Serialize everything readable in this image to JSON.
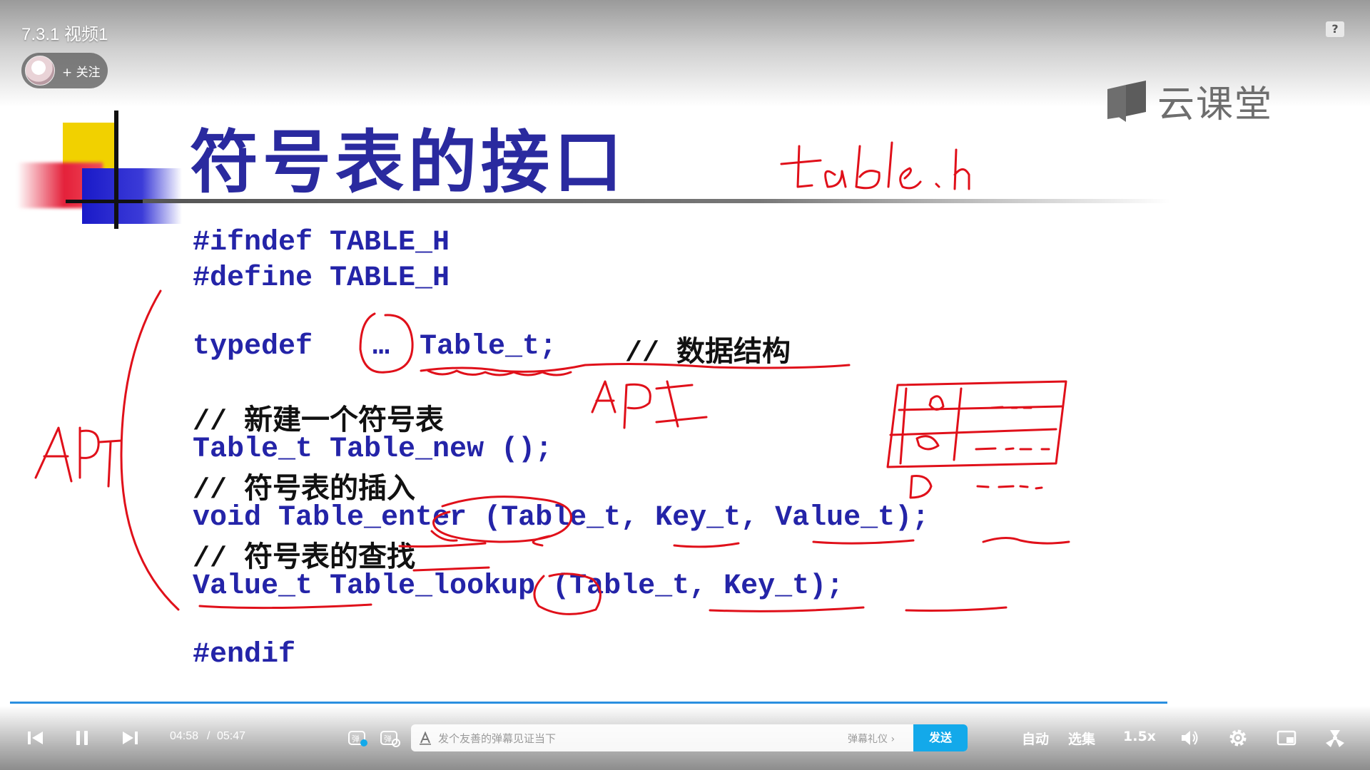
{
  "player": {
    "video_title": "7.3.1 视频1",
    "follow_label": "+ 关注",
    "help_label": "?",
    "brand_text": "云课堂",
    "current_time": "04:58",
    "time_separator": "/",
    "duration": "05:47",
    "progress_fraction": 0.858,
    "danmaku_placeholder": "发个友善的弹幕见证当下",
    "danmaku_etiquette": "弹幕礼仪 ›",
    "send_label": "发送",
    "auto_label": "自动",
    "episodes_label": "选集",
    "speed_label": "1.5x",
    "accent_color": "#13a9ea"
  },
  "slide": {
    "title": "符号表的接口",
    "code_lines": {
      "ifndef": "#ifndef TABLE_H",
      "define": "#define TABLE_H",
      "typedef_kw": "typedef",
      "typedef_dots": "…",
      "typedef_type": "Table_t;",
      "typedef_comment": "// 数据结构",
      "comment_new": "// 新建一个符号表",
      "fn_new": "Table_t Table_new ();",
      "comment_insert": "// 符号表的插入",
      "fn_enter": "void Table_enter (Table_t, Key_t, Value_t);",
      "comment_lookup": "// 符号表的查找",
      "fn_lookup": "Value_t Table_lookup (Table_t, Key_t);",
      "endif": "#endif"
    }
  },
  "icons": [
    "prev-icon",
    "pause-icon",
    "next-icon",
    "danmaku-toggle-icon",
    "danmaku-settings-icon",
    "text-style-icon",
    "volume-icon",
    "settings-icon",
    "pip-icon",
    "fullscreen-icon",
    "help-icon",
    "brand-logo-icon"
  ]
}
